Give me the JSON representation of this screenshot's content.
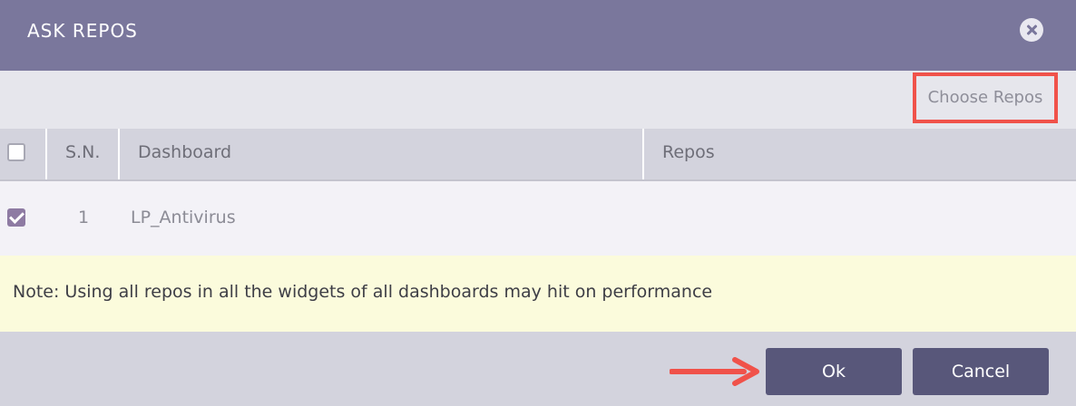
{
  "dialog": {
    "title": "ASK REPOS",
    "close_icon": "close-icon"
  },
  "toolbar": {
    "choose_repos_label": "Choose Repos",
    "highlight_color": "#f0524a"
  },
  "table": {
    "columns": [
      "S.N.",
      "Dashboard",
      "Repos"
    ],
    "rows": [
      {
        "checked": true,
        "sn": "1",
        "dashboard": "LP_Antivirus",
        "repos": ""
      }
    ]
  },
  "note": {
    "text": "Note: Using all repos in all the widgets of all dashboards may hit on performance"
  },
  "footer": {
    "ok_label": "Ok",
    "cancel_label": "Cancel",
    "annotation_arrow_color": "#f0524a"
  },
  "colors": {
    "header_bg": "#7a779c",
    "button_bg": "#58577a",
    "checkbox_checked": "#8e7ba3",
    "note_bg": "#fbfbdc"
  }
}
